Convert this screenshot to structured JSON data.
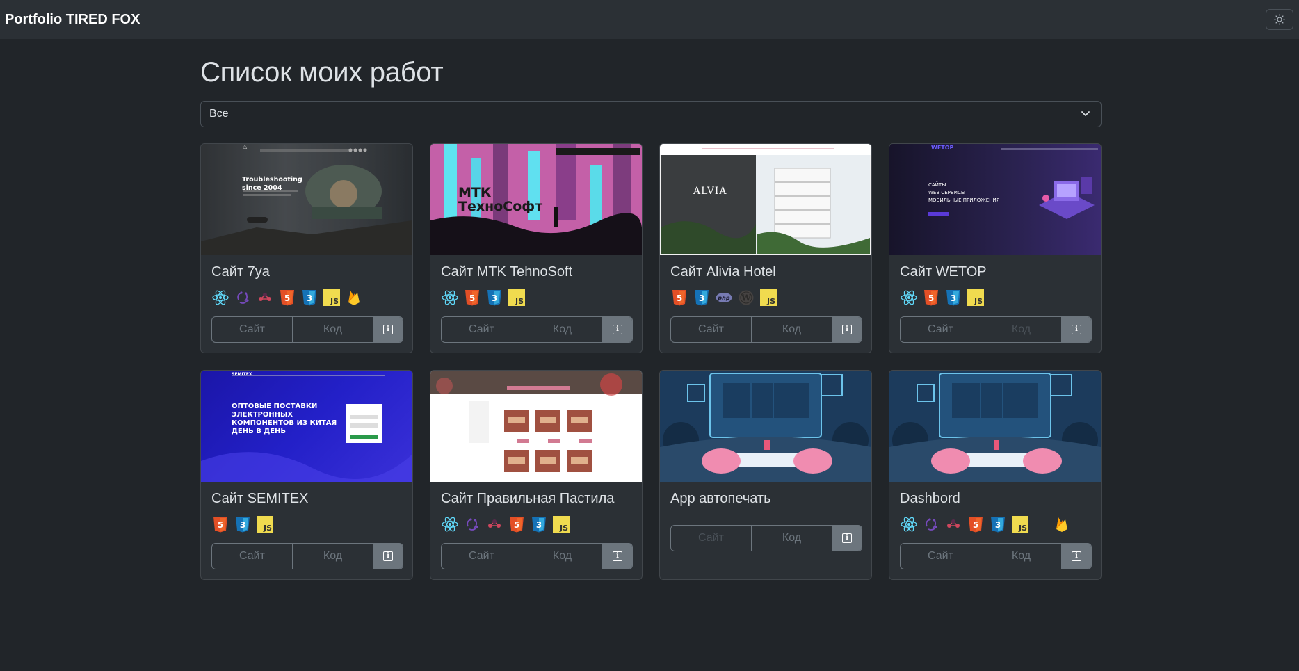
{
  "navbar": {
    "brand": "Portfolio TIRED FOX",
    "theme_icon": "sun-icon"
  },
  "page": {
    "title": "Список моих работ"
  },
  "filter": {
    "selected": "Все"
  },
  "colors": {
    "bg": "#212529",
    "card": "#2b3035",
    "muted": "#6c757d"
  },
  "buttons": {
    "site": "Сайт",
    "code": "Код"
  },
  "projects": [
    {
      "title": "Сайт 7ya",
      "techs": [
        "react",
        "redux",
        "rtk",
        "html5",
        "css3",
        "js",
        "firebase"
      ]
    },
    {
      "title": "Сайт MTK TehnoSoft",
      "techs": [
        "react",
        "html5",
        "css3",
        "js"
      ]
    },
    {
      "title": "Сайт Alivia Hotel",
      "techs": [
        "html5",
        "css3",
        "php",
        "wordpress",
        "js"
      ]
    },
    {
      "title": "Сайт WETOP",
      "techs": [
        "react",
        "html5",
        "css3",
        "js"
      ]
    },
    {
      "title": "Сайт SEMITEX",
      "techs": [
        "html5",
        "css3",
        "js"
      ]
    },
    {
      "title": "Сайт Правильная Пастила",
      "techs": [
        "react",
        "redux",
        "rtk",
        "html5",
        "css3",
        "js"
      ]
    },
    {
      "title": "App автопечать",
      "techs": []
    },
    {
      "title": "Dashbord",
      "techs": [
        "react",
        "redux",
        "rtk",
        "html5",
        "css3",
        "js",
        "firebase"
      ]
    }
  ],
  "thumbnails": {
    "p0": {
      "heading": "Troubleshooting since 2004"
    },
    "p1": {
      "heading": "МТК ТехноСофт"
    },
    "p2": {
      "heading": "ALVIA"
    },
    "p3": {
      "heading": "САЙТЫ\nWEB СЕРВИСЫ\nМОБИЛЬНЫЕ ПРИЛОЖЕНИЯ",
      "logo": "WETOP"
    },
    "p4": {
      "heading": "ОПТОВЫЕ ПОСТАВКИ ЭЛЕКТРОННЫХ КОМПОНЕНТОВ ИЗ КИТАЯ ДЕНЬ В ДЕНЬ",
      "logo": "SEMITEX"
    }
  }
}
